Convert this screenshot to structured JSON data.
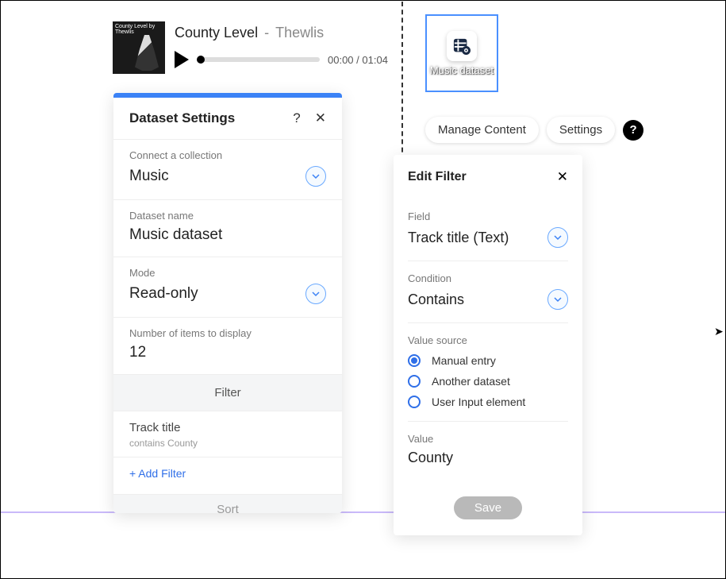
{
  "audio": {
    "album_art_text": "County Level by Thewlis",
    "title": "County Level",
    "artist": "Thewlis",
    "time_elapsed": "00:00",
    "time_total": "01:04"
  },
  "canvas_element": {
    "label": "Music dataset"
  },
  "toolbar": {
    "manage_content": "Manage Content",
    "settings": "Settings",
    "help_glyph": "?"
  },
  "dataset_settings": {
    "title": "Dataset Settings",
    "help_glyph": "?",
    "close_glyph": "✕",
    "connect_label": "Connect a collection",
    "connect_value": "Music",
    "name_label": "Dataset name",
    "name_value": "Music dataset",
    "mode_label": "Mode",
    "mode_value": "Read-only",
    "items_label": "Number of items to display",
    "items_value": "12",
    "filter_heading": "Filter",
    "filter_item_title": "Track title",
    "filter_item_sub": "contains County",
    "add_filter": "+ Add Filter",
    "sort_heading": "Sort"
  },
  "edit_filter": {
    "title": "Edit Filter",
    "close_glyph": "✕",
    "field_label": "Field",
    "field_value": "Track title (Text)",
    "condition_label": "Condition",
    "condition_value": "Contains",
    "value_source_label": "Value source",
    "sources": {
      "manual": "Manual entry",
      "another": "Another dataset",
      "user_input": "User Input element"
    },
    "selected_source": "manual",
    "value_label": "Value",
    "value": "County",
    "save": "Save"
  }
}
